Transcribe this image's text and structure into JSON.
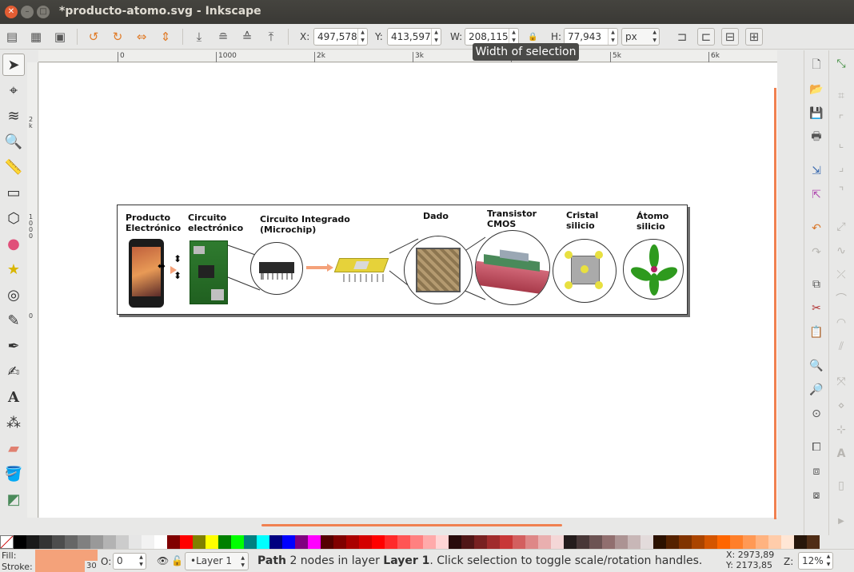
{
  "window": {
    "title": "*producto-atomo.svg - Inkscape"
  },
  "toolbar": {
    "x_label": "X:",
    "x_value": "497,578",
    "y_label": "Y:",
    "y_value": "413,597",
    "w_label": "W:",
    "w_value": "208,115",
    "h_label": "H:",
    "h_value": "77,943",
    "unit": "px",
    "tooltip": "Width of selection"
  },
  "ruler": {
    "h_ticks": [
      "0",
      "1000",
      "2k",
      "3k",
      "4k",
      "5k",
      "6k"
    ],
    "v_ticks": [
      "2k",
      "1000",
      "0"
    ]
  },
  "figure": {
    "labels": [
      "Producto\nElectrónico",
      "Circuito\nelectrónico",
      "Circuito Integrado\n(Microchip)",
      "Dado",
      "Transistor\nCMOS",
      "Cristal\nsilicio",
      "Átomo\nsilicio"
    ]
  },
  "tools": [
    "selector-tool",
    "node-tool",
    "tweak-tool",
    "zoom-tool",
    "measure-tool",
    "rectangle-tool",
    "3d-box-tool",
    "ellipse-tool",
    "star-tool",
    "spiral-tool",
    "pencil-tool",
    "pen-tool",
    "calligraphy-tool",
    "text-tool",
    "spray-tool",
    "eraser-tool",
    "bucket-tool",
    "gradient-tool"
  ],
  "status": {
    "fill_label": "Fill:",
    "stroke_label": "Stroke:",
    "stroke_width": "30",
    "opacity_label": "O:",
    "opacity_value": "0",
    "layer": "•Layer 1",
    "msg_obj": "Path",
    "msg_a": " 2 nodes in layer ",
    "msg_layer": "Layer 1",
    "msg_b": ". Click selection to toggle scale/rotation handles.",
    "x_coord": "X: 2973,89",
    "y_coord": "Y: 2173,85",
    "zoom_label": "Z:",
    "zoom_value": "12%"
  },
  "palette": [
    "#000000",
    "#1a1a1a",
    "#333333",
    "#4d4d4d",
    "#666666",
    "#808080",
    "#999999",
    "#b3b3b3",
    "#cccccc",
    "#e6e6e6",
    "#f2f2f2",
    "#ffffff",
    "#800000",
    "#ff0000",
    "#808000",
    "#ffff00",
    "#008000",
    "#00ff00",
    "#008080",
    "#00ffff",
    "#000080",
    "#0000ff",
    "#800080",
    "#ff00ff",
    "#550000",
    "#800000",
    "#aa0000",
    "#d40000",
    "#ff0000",
    "#ff2a2a",
    "#ff5555",
    "#ff8080",
    "#ffaaaa",
    "#ffd5d5",
    "#280b0b",
    "#501616",
    "#782121",
    "#a02c2c",
    "#c83737",
    "#d35f5f",
    "#de8787",
    "#e9afaf",
    "#f4d7d7",
    "#241c1c",
    "#483737",
    "#6c5353",
    "#916f6f",
    "#ac9393",
    "#c8b7b7",
    "#e3dbdb",
    "#2b1100",
    "#552200",
    "#803300",
    "#aa4400",
    "#d45500",
    "#ff6600",
    "#ff7f2a",
    "#ff9955",
    "#ffb380",
    "#ffccaa",
    "#ffe6d5",
    "#28170b",
    "#502d16"
  ]
}
